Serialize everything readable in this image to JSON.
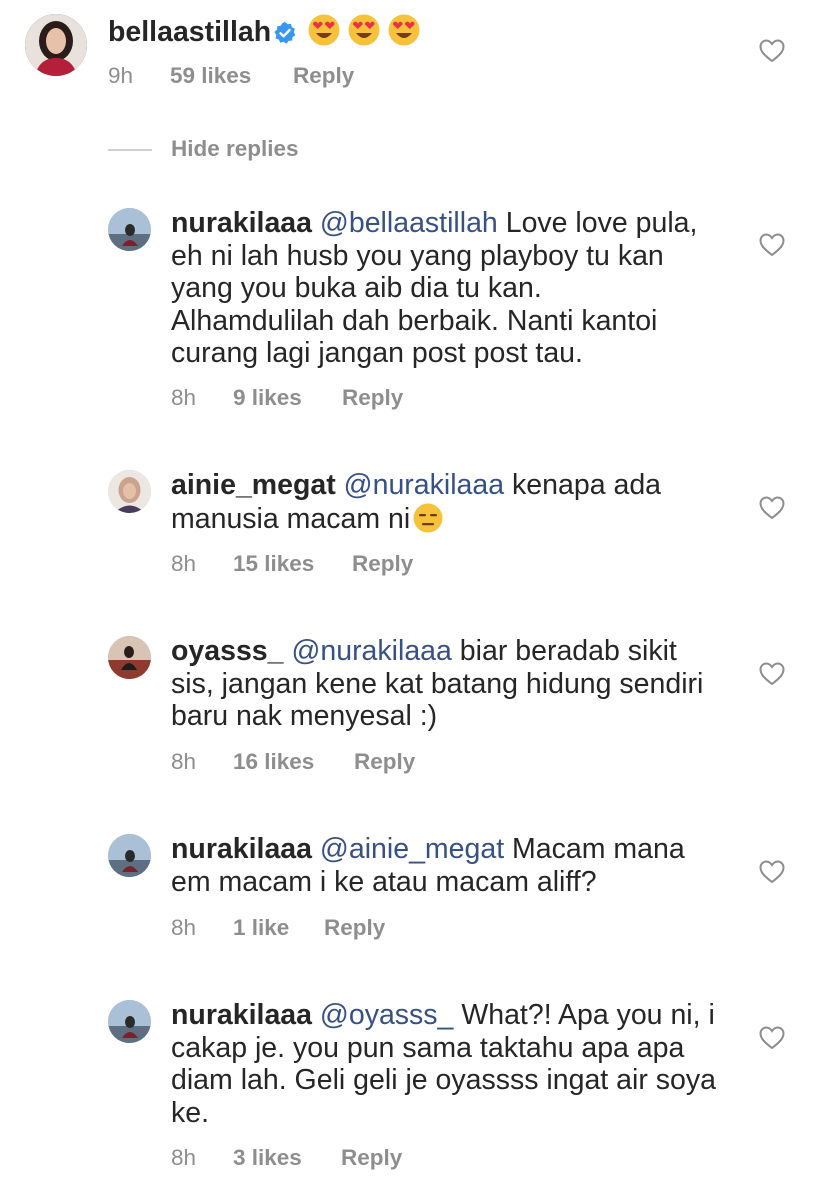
{
  "comments": [
    {
      "username": "bellaastillah",
      "verified": true,
      "mention": "",
      "text": "",
      "emoji": [
        "heart-eyes-emoji",
        "heart-eyes-emoji",
        "heart-eyes-emoji"
      ],
      "time": "9h",
      "likes": "59 likes",
      "reply": "Reply"
    },
    {
      "username": "nurakilaaa",
      "mention": "@bellaastillah",
      "lines": [
        " Love love pula,",
        "eh ni lah husb you yang playboy tu kan",
        "yang you buka aib  dia tu kan.",
        "Alhamdulilah dah berbaik. Nanti kantoi",
        "curang lagi jangan post post tau."
      ],
      "time": "8h",
      "likes": "9 likes",
      "reply": "Reply"
    },
    {
      "username": "ainie_megat",
      "mention": "@nurakilaaa",
      "lines": [
        " kenapa ada",
        "manusia macam ni"
      ],
      "emoji": "expressionless-face-emoji",
      "time": "8h",
      "likes": "15 likes",
      "reply": "Reply"
    },
    {
      "username": "oyasss_",
      "mention": "@nurakilaaa",
      "lines": [
        " biar beradab sikit",
        "sis, jangan kene kat batang hidung sendiri",
        "baru nak menyesal :)"
      ],
      "time": "8h",
      "likes": "16 likes",
      "reply": "Reply"
    },
    {
      "username": "nurakilaaa",
      "mention": "@ainie_megat",
      "lines": [
        " Macam mana",
        "em macam i ke atau macam aliff?"
      ],
      "time": "8h",
      "likes": "1 like",
      "reply": "Reply"
    },
    {
      "username": "nurakilaaa",
      "mention": "@oyasss_",
      "lines": [
        " What?! Apa you ni, i",
        "cakap je. you pun sama taktahu apa apa",
        "diam lah. Geli geli je oyassss ingat air soya",
        "ke."
      ],
      "time": "8h",
      "likes": "3 likes",
      "reply": "Reply"
    }
  ],
  "hide_replies": "Hide replies",
  "icons": {
    "like": "heart-outline-icon",
    "verified": "verified-badge-icon"
  },
  "colors": {
    "text": "#262626",
    "mention": "#385185",
    "meta": "#8e8e8e",
    "verified": "#3897f0"
  }
}
